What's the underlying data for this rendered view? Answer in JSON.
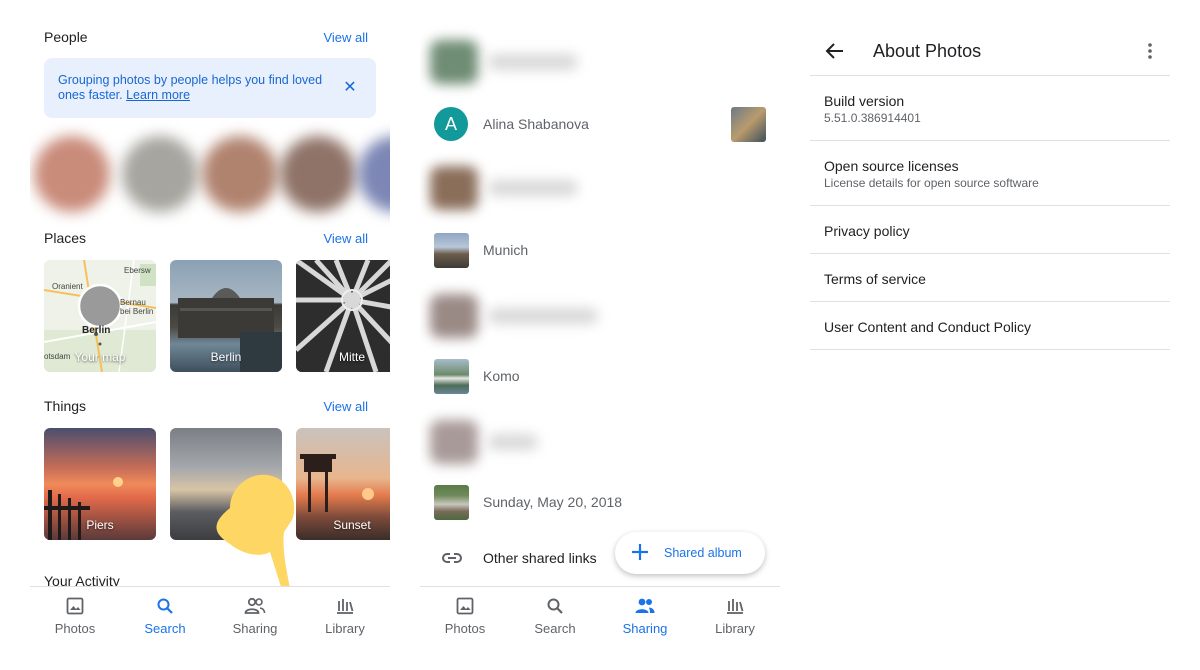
{
  "search_screen": {
    "people": {
      "title": "People",
      "view_all": "View all"
    },
    "banner": {
      "text": "Grouping photos by people helps you find loved ones faster.",
      "link": "Learn more"
    },
    "places": {
      "title": "Places",
      "view_all": "View all",
      "tiles": [
        "Your map",
        "Berlin",
        "Mitte"
      ],
      "map_labels": [
        "Ebersw",
        "Oranient",
        "Bernau",
        "bei Berlin",
        "Berlin",
        "otsdam"
      ]
    },
    "things": {
      "title": "Things",
      "view_all": "View all",
      "tiles": [
        "Piers",
        "",
        "Sunset"
      ]
    },
    "activity": {
      "title": "Your Activity"
    },
    "nav": {
      "items": [
        {
          "label": "Photos",
          "icon": "photo-icon"
        },
        {
          "label": "Search",
          "icon": "search-icon"
        },
        {
          "label": "Sharing",
          "icon": "people-icon"
        },
        {
          "label": "Library",
          "icon": "library-icon"
        }
      ],
      "active": "Search"
    }
  },
  "sharing_screen": {
    "rows": [
      {
        "name": "Alina Shabanova",
        "avatar_letter": "A"
      },
      {
        "name": "Munich"
      },
      {
        "name": "Komo"
      },
      {
        "name": "Sunday, May 20, 2018"
      }
    ],
    "other_links": "Other shared links",
    "fab": "Shared album",
    "nav": {
      "items": [
        {
          "label": "Photos",
          "icon": "photo-icon"
        },
        {
          "label": "Search",
          "icon": "search-icon"
        },
        {
          "label": "Sharing",
          "icon": "people-icon"
        },
        {
          "label": "Library",
          "icon": "library-icon"
        }
      ],
      "active": "Sharing"
    }
  },
  "about_screen": {
    "title": "About Photos",
    "items": [
      {
        "title": "Build version",
        "subtitle": "5.51.0.386914401"
      },
      {
        "title": "Open source licenses",
        "subtitle": "License details for open source software"
      },
      {
        "title": "Privacy policy"
      },
      {
        "title": "Terms of service"
      },
      {
        "title": "User Content and Conduct Policy"
      }
    ]
  },
  "colors": {
    "accent": "#1a73e8",
    "avatar": "#12999a",
    "banner_bg": "#e8f0fe",
    "hand": "#fdd663"
  }
}
